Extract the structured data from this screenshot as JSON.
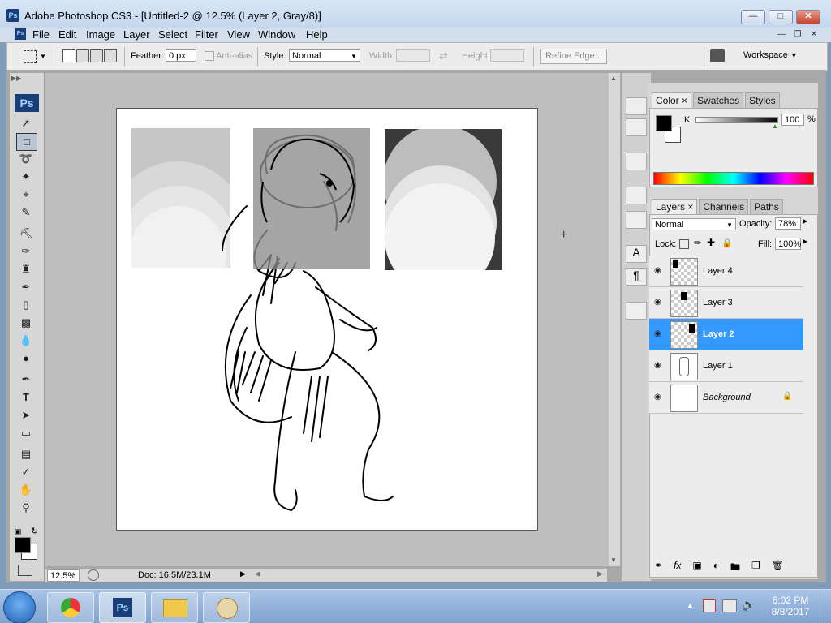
{
  "window": {
    "title": "Adobe Photoshop CS3 - [Untitled-2 @ 12.5% (Layer 2, Gray/8)]",
    "app_badge": "Ps"
  },
  "menu": [
    "File",
    "Edit",
    "Image",
    "Layer",
    "Select",
    "Filter",
    "View",
    "Window",
    "Help"
  ],
  "options": {
    "feather_label": "Feather:",
    "feather_value": "0 px",
    "antialias_label": "Anti-alias",
    "style_label": "Style:",
    "style_value": "Normal",
    "width_label": "Width:",
    "height_label": "Height:",
    "refine_edge": "Refine Edge...",
    "workspace": "Workspace"
  },
  "toolbox": {
    "badge": "Ps",
    "icons": [
      "move-icon",
      "marquee-icon",
      "lasso-icon",
      "magic-wand-icon",
      "crop-icon",
      "slice-icon",
      "healing-brush-icon",
      "brush-icon",
      "clone-stamp-icon",
      "history-brush-icon",
      "eraser-icon",
      "gradient-icon",
      "blur-icon",
      "dodge-icon",
      "pen-icon",
      "type-icon",
      "path-selection-icon",
      "rectangle-icon",
      "notes-icon",
      "eyedropper-icon",
      "hand-icon",
      "zoom-icon"
    ]
  },
  "status": {
    "zoom": "12.5%",
    "doc": "Doc: 16.5M/23.1M"
  },
  "color_panel": {
    "tabs": [
      "Color",
      "Swatches",
      "Styles"
    ],
    "channel_label": "K",
    "channel_value": "100",
    "unit": "%"
  },
  "layers_panel": {
    "tabs": [
      "Layers",
      "Channels",
      "Paths"
    ],
    "blend_mode": "Normal",
    "opacity_label": "Opacity:",
    "opacity_value": "78%",
    "lock_label": "Lock:",
    "fill_label": "Fill:",
    "fill_value": "100%",
    "layers": [
      {
        "name": "Layer 4",
        "selected": false
      },
      {
        "name": "Layer 3",
        "selected": false
      },
      {
        "name": "Layer 2",
        "selected": true
      },
      {
        "name": "Layer 1",
        "selected": false
      },
      {
        "name": "Background",
        "selected": false
      }
    ]
  },
  "taskbar": {
    "time": "6:02 PM",
    "date": "8/8/2017",
    "ps_label": "Ps"
  },
  "colors": {
    "selection": "#3399ff",
    "canvas_bg": "#bebebe",
    "ps_blue": "#1a3f78"
  }
}
